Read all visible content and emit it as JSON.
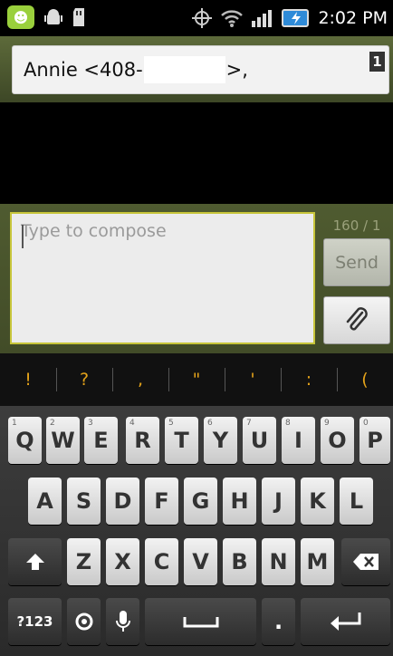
{
  "status_bar": {
    "time": "2:02 PM",
    "icons": [
      "message-notification-icon",
      "android-debug-icon",
      "sd-card-icon",
      "gps-icon",
      "wifi-icon",
      "signal-icon",
      "battery-charging-icon"
    ]
  },
  "recipient": {
    "name_prefix": "Annie <408-",
    "name_suffix": ">,",
    "count_badge": "1"
  },
  "compose": {
    "placeholder": "Type to compose",
    "char_counter": "160 / 1",
    "send_label": "Send"
  },
  "suggestions": [
    "!",
    "?",
    ",",
    "\"",
    "'",
    ":",
    "("
  ],
  "keyboard": {
    "row1": [
      {
        "label": "Q",
        "hint": "1"
      },
      {
        "label": "W",
        "hint": "2"
      },
      {
        "label": "E",
        "hint": "3"
      },
      {
        "label": "R",
        "hint": "4"
      },
      {
        "label": "T",
        "hint": "5"
      },
      {
        "label": "Y",
        "hint": "6"
      },
      {
        "label": "U",
        "hint": "7"
      },
      {
        "label": "I",
        "hint": "8"
      },
      {
        "label": "O",
        "hint": "9"
      },
      {
        "label": "P",
        "hint": "0"
      }
    ],
    "row2": [
      "A",
      "S",
      "D",
      "F",
      "G",
      "H",
      "J",
      "K",
      "L"
    ],
    "row3": [
      "Z",
      "X",
      "C",
      "V",
      "B",
      "N",
      "M"
    ],
    "symbols_label": "?123",
    "period_label": "."
  },
  "colors": {
    "accent_send_bar": "#4f5b30",
    "suggest_text": "#e3a21a",
    "compose_border": "#c7c53a"
  }
}
